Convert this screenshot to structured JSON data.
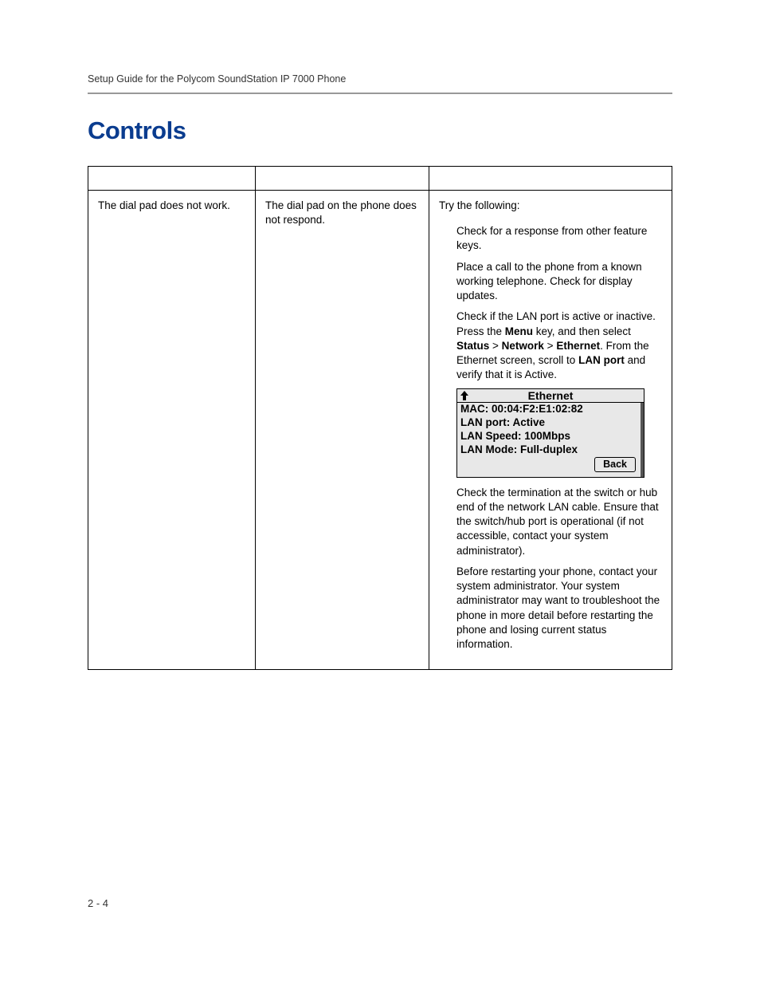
{
  "header": {
    "guide_title": "Setup Guide for the Polycom SoundStation IP 7000 Phone"
  },
  "section": {
    "title": "Controls"
  },
  "table": {
    "row1": {
      "symptom": "The dial pad does not work.",
      "problem": "The dial pad on the phone does not respond.",
      "action_intro": "Try the following:",
      "bullet1": "Check for a response from other feature keys.",
      "bullet2": "Place a call to the phone from a known working telephone. Check for display updates.",
      "bullet3_a": "Check if the LAN port is active or inactive. Press the ",
      "bullet3_menu": "Menu",
      "bullet3_b": " key, and then select ",
      "bullet3_status": "Status",
      "bullet3_gt1": " > ",
      "bullet3_network": "Network",
      "bullet3_gt2": " > ",
      "bullet3_ethernet": "Ethernet",
      "bullet3_c": ". From the Ethernet screen, scroll to ",
      "bullet3_lanport": "LAN port",
      "bullet3_d": " and verify that it is Active.",
      "bullet4": "Check the termination at the switch or hub end of the network LAN cable. Ensure that the switch/hub port is operational (if not accessible, contact your system administrator).",
      "bullet5": "Before restarting your phone, contact your system administrator. Your system administrator may want to troubleshoot the phone in more detail before restarting the phone and losing current status information."
    }
  },
  "lcd": {
    "title": "Ethernet",
    "mac": "MAC: 00:04:F2:E1:02:82",
    "lan_port": "LAN port: Active",
    "lan_speed": "LAN Speed: 100Mbps",
    "lan_mode": "LAN Mode: Full-duplex",
    "back": "Back"
  },
  "footer": {
    "page_number": "2 - 4"
  }
}
